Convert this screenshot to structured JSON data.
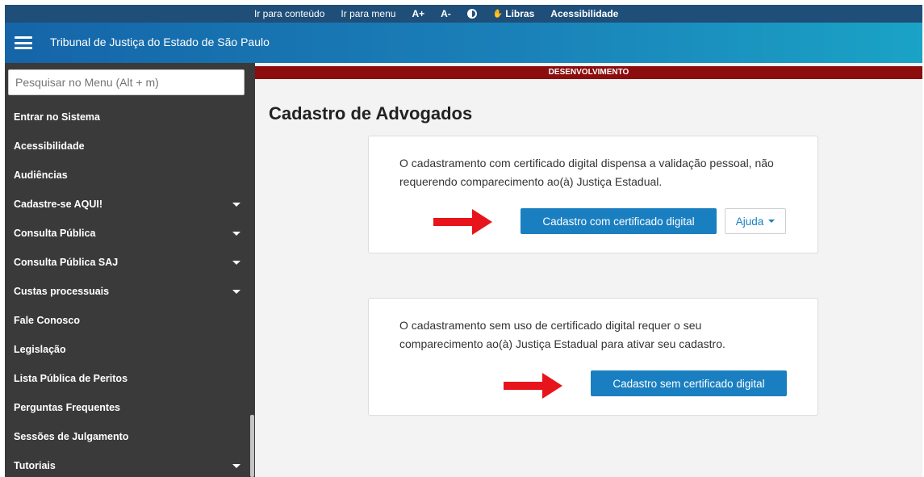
{
  "topbar": {
    "links": [
      {
        "label": "Ir para conteúdo"
      },
      {
        "label": "Ir para menu"
      },
      {
        "label": "A+"
      },
      {
        "label": "A-"
      },
      {
        "label": "Libras"
      },
      {
        "label": "Acessibilidade"
      }
    ]
  },
  "header": {
    "title": "Tribunal de Justiça do Estado de São Paulo"
  },
  "sidebar": {
    "search_placeholder": "Pesquisar no Menu (Alt + m)",
    "items": [
      {
        "label": "Entrar no Sistema",
        "has_submenu": false
      },
      {
        "label": "Acessibilidade",
        "has_submenu": false
      },
      {
        "label": "Audiências",
        "has_submenu": false
      },
      {
        "label": "Cadastre-se AQUI!",
        "has_submenu": true
      },
      {
        "label": "Consulta Pública",
        "has_submenu": true
      },
      {
        "label": "Consulta Pública SAJ",
        "has_submenu": true
      },
      {
        "label": "Custas processuais",
        "has_submenu": true
      },
      {
        "label": "Fale Conosco",
        "has_submenu": false
      },
      {
        "label": "Legislação",
        "has_submenu": false
      },
      {
        "label": "Lista Pública de Peritos",
        "has_submenu": false
      },
      {
        "label": "Perguntas Frequentes",
        "has_submenu": false
      },
      {
        "label": "Sessões de Julgamento",
        "has_submenu": false
      },
      {
        "label": "Tutoriais",
        "has_submenu": true
      }
    ]
  },
  "main": {
    "env_banner": "DESENVOLVIMENTO",
    "page_title": "Cadastro de Advogados",
    "card_with_cert": {
      "text": "O cadastramento com certificado digital dispensa a validação pessoal, não requerendo comparecimento ao(à) Justiça Estadual.",
      "button": "Cadastro com certificado digital",
      "help_button": "Ajuda"
    },
    "card_without_cert": {
      "text": "O cadastramento sem uso de certificado digital requer o seu comparecimento ao(à) Justiça Estadual para ativar seu cadastro.",
      "button": "Cadastro sem certificado digital"
    }
  },
  "colors": {
    "topbar": "#1f4e79",
    "header_start": "#1565a8",
    "header_end": "#1aa3c6",
    "sidebar": "#3a3a3a",
    "env_banner": "#8b0d0d",
    "primary_button": "#1a7fc1",
    "annotation_arrow": "#e8141b"
  },
  "icons": {
    "menu": "hamburger-icon",
    "contrast": "contrast-icon",
    "libras": "hand-icon",
    "submenu": "caret-down-icon",
    "annotation": "red-arrow-icon"
  }
}
